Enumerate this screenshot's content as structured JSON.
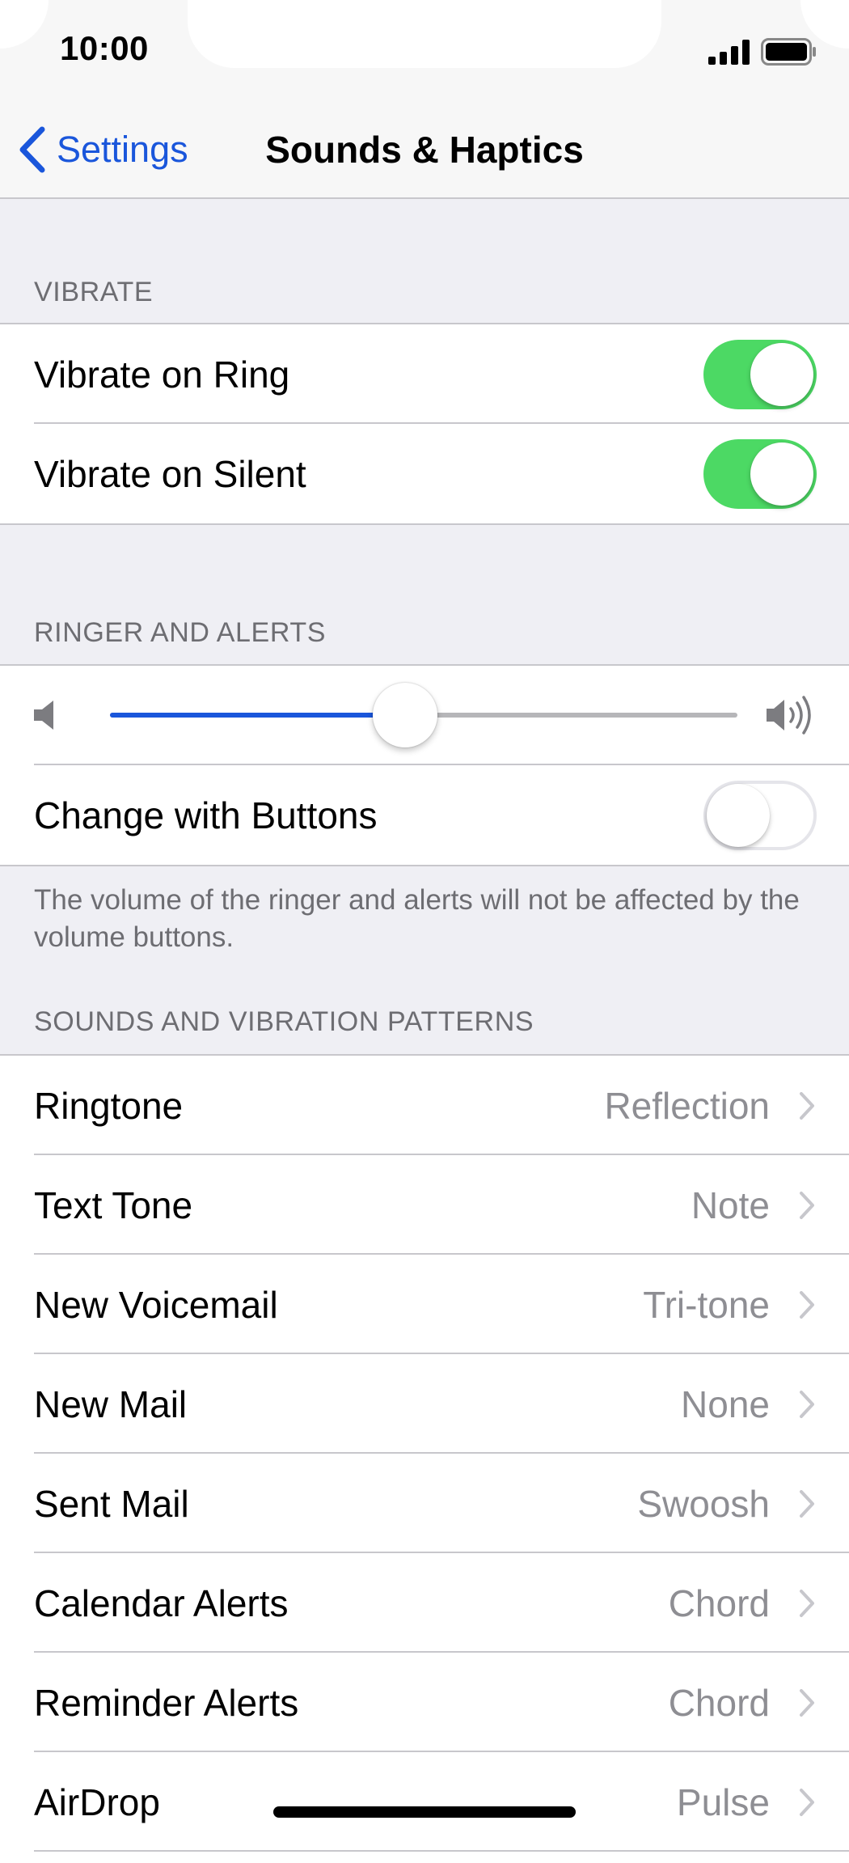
{
  "status_bar": {
    "time": "10:00",
    "icons": [
      "cellular-signal-icon",
      "battery-icon"
    ]
  },
  "nav": {
    "back_label": "Settings",
    "title": "Sounds & Haptics"
  },
  "vibrate": {
    "header": "VIBRATE",
    "rows": [
      {
        "label": "Vibrate on Ring",
        "on": true
      },
      {
        "label": "Vibrate on Silent",
        "on": true
      }
    ]
  },
  "ringer": {
    "header": "RINGER AND ALERTS",
    "volume_fraction": 0.47,
    "change_with_buttons": {
      "label": "Change with Buttons",
      "on": false
    },
    "note": "The volume of the ringer and alerts will not be affected by the volume buttons."
  },
  "sounds": {
    "header": "SOUNDS AND VIBRATION PATTERNS",
    "rows": [
      {
        "label": "Ringtone",
        "value": "Reflection"
      },
      {
        "label": "Text Tone",
        "value": "Note"
      },
      {
        "label": "New Voicemail",
        "value": "Tri-tone"
      },
      {
        "label": "New Mail",
        "value": "None"
      },
      {
        "label": "Sent Mail",
        "value": "Swoosh"
      },
      {
        "label": "Calendar Alerts",
        "value": "Chord"
      },
      {
        "label": "Reminder Alerts",
        "value": "Chord"
      },
      {
        "label": "AirDrop",
        "value": "Pulse"
      }
    ]
  },
  "colors": {
    "accent": "#1a56db",
    "toggle_on": "#4cd964",
    "background": "#efeff4",
    "separator": "#c8c7cc",
    "secondary_text": "#8e8e93"
  }
}
